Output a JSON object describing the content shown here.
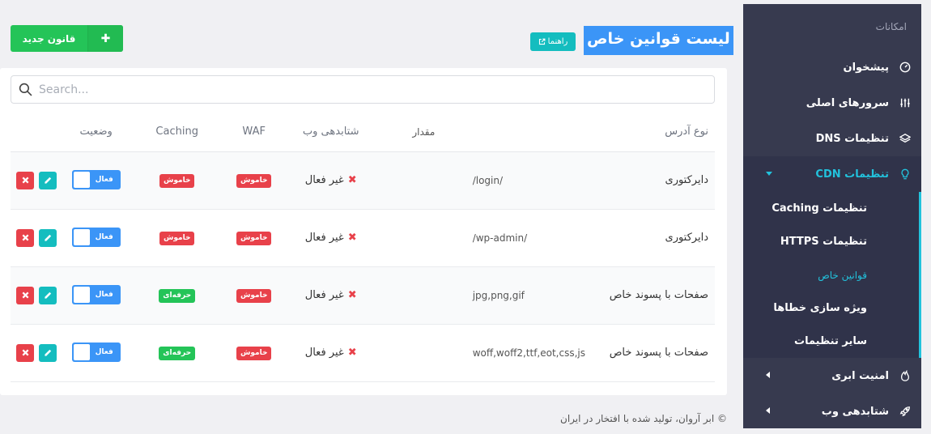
{
  "sidebar": {
    "header": "امکانات",
    "items": [
      {
        "label": "پیشخوان",
        "icon": "gauge-icon"
      },
      {
        "label": "سرورهای اصلی",
        "icon": "sliders-icon"
      },
      {
        "label": "تنظیمات DNS",
        "icon": "layers-icon"
      },
      {
        "label": "تنظیمات CDN",
        "icon": "lightbulb-icon",
        "active": true
      },
      {
        "label": "امنیت ابری",
        "icon": "fire-icon"
      },
      {
        "label": "شتابدهی وب",
        "icon": "rocket-icon"
      }
    ],
    "cdn_sub": [
      {
        "label": "تنظیمات Caching"
      },
      {
        "label": "تنظیمات HTTPS"
      },
      {
        "label": "قوانین خاص",
        "current": true
      },
      {
        "label": "ویژه سازی خطاها"
      },
      {
        "label": "سایر تنظیمات"
      }
    ]
  },
  "header": {
    "title": "لیست قوانین خاص",
    "guide_label": "راهنما",
    "new_rule_label": "قانون جدید"
  },
  "search": {
    "placeholder": "Search..."
  },
  "table": {
    "columns": {
      "type": "نوع آدرس",
      "value": "مقدار",
      "cdn": "شتابدهی وب",
      "waf": "WAF",
      "caching": "Caching",
      "status": "وضعیت"
    },
    "rows": [
      {
        "type": "دایرکتوری",
        "value": "/login/",
        "cdn": "غیر فعال",
        "waf": "خاموش",
        "caching": "خاموش",
        "caching_color": "#e8414a",
        "status": "فعال"
      },
      {
        "type": "دایرکتوری",
        "value": "/wp-admin/",
        "cdn": "غیر فعال",
        "waf": "خاموش",
        "caching": "خاموش",
        "caching_color": "#e8414a",
        "status": "فعال"
      },
      {
        "type": "صفحات با پسوند خاص",
        "value": "jpg,png,gif",
        "cdn": "غیر فعال",
        "waf": "خاموش",
        "caching": "حرفه‌ای",
        "caching_color": "#24c458",
        "status": "فعال"
      },
      {
        "type": "صفحات با پسوند خاص",
        "value": "woff,woff2,ttf,eot,css,js",
        "cdn": "غیر فعال",
        "waf": "خاموش",
        "caching": "حرفه‌ای",
        "caching_color": "#24c458",
        "status": "فعال"
      }
    ]
  },
  "footer": {
    "text": "© ابر آروان، تولید شده با افتخار در ایران"
  }
}
